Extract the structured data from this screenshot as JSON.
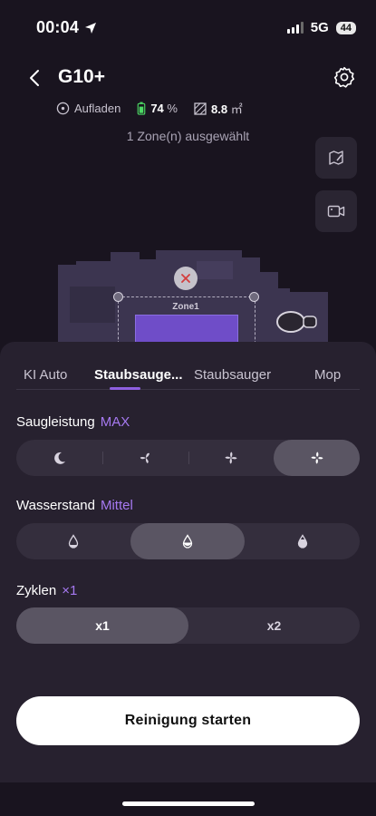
{
  "status_bar": {
    "time": "00:04",
    "network": "5G",
    "battery": "44"
  },
  "header": {
    "title": "G10+",
    "status_label": "Aufladen",
    "battery_value": "74",
    "battery_unit": "%",
    "area_value": "8.8",
    "area_unit": "㎡",
    "zone_selection": "1 Zone(n) ausgewählt"
  },
  "map": {
    "zone_label": "Zone1"
  },
  "tabs": [
    {
      "label": "KI Auto"
    },
    {
      "label": "Staubsauge..."
    },
    {
      "label": "Staubsauger"
    },
    {
      "label": "Mop"
    }
  ],
  "suction": {
    "label": "Saugleistung",
    "value": "MAX"
  },
  "water": {
    "label": "Wasserstand",
    "value": "Mittel"
  },
  "cycles": {
    "label": "Zyklen",
    "value": "×1",
    "options": [
      "x1",
      "x2"
    ]
  },
  "start_button": "Reinigung starten",
  "colors": {
    "accent": "#a679f1",
    "sheet": "#27212f",
    "background": "#19141f"
  }
}
